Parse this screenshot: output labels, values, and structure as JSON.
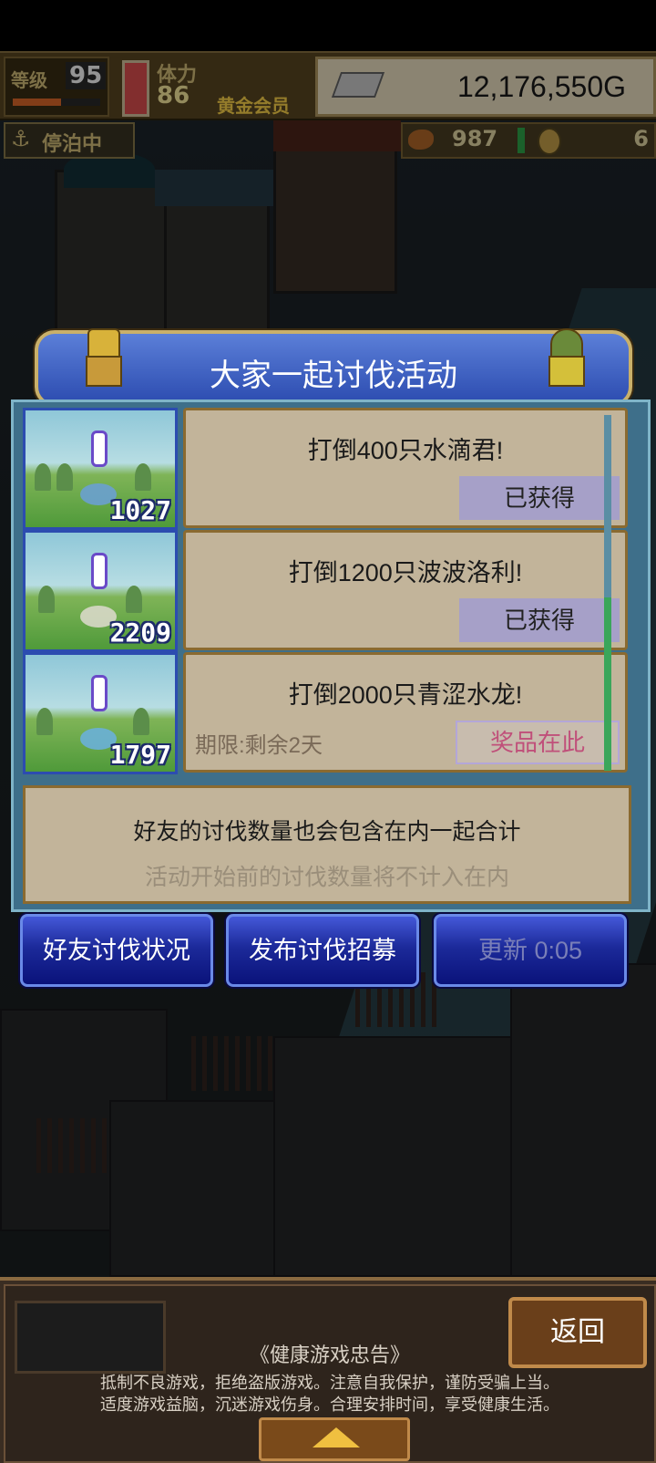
{
  "hud": {
    "level_label": "等级",
    "level": "95",
    "level_progress": 0.55,
    "stamina_label": "体力",
    "stamina": "86",
    "membership": "黄金会员",
    "money": "12,176,550G",
    "status": "停泊中",
    "food": "987",
    "coins": "6"
  },
  "event": {
    "title": "大家一起讨伐活动",
    "quests": [
      {
        "count": "1027",
        "title": "打倒400只水滴君!",
        "status": "已获得",
        "deadline": ""
      },
      {
        "count": "2209",
        "title": "打倒1200只波波洛利!",
        "status": "已获得",
        "deadline": ""
      },
      {
        "count": "1797",
        "title": "打倒2000只青涩水龙!",
        "status": "奖品在此",
        "deadline": "期限:剩余2天"
      }
    ],
    "info_main": "好友的讨伐数量也会包含在内一起合计",
    "info_sub": "活动开始前的讨伐数量将不计入在内"
  },
  "buttons": {
    "friends_status": "好友讨伐状况",
    "post_recruit": "发布讨伐招募",
    "refresh": "更新 0:05"
  },
  "footer": {
    "return_label": "返回",
    "advisory_title": "《健康游戏忠告》",
    "advisory_line1": "抵制不良游戏，拒绝盗版游戏。注意自我保护，谨防受骗上当。",
    "advisory_line2": "适度游戏益脑，沉迷游戏伤身。合理安排时间，享受健康生活。"
  },
  "colors": {
    "panel_blue": "#2c4cb0",
    "card_tan": "#c2b49a",
    "claimed_lavender": "#a6a0c8",
    "reward_pink": "#c0507a"
  }
}
